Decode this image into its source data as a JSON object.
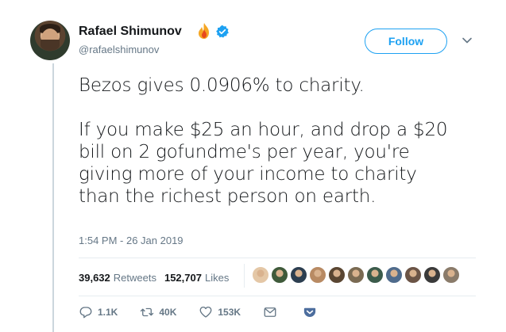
{
  "author": {
    "name": "Rafael Shimunov",
    "handle": "@rafaelshimunov",
    "badges": [
      "fire-emoji",
      "verified-badge"
    ]
  },
  "follow_label": "Follow",
  "tweet": {
    "line1": "Bezos gives 0.0906% to charity.",
    "line2": "If you make $25 an hour, and drop a $20",
    "line3": "bill on 2 gofundme's per year, you're",
    "line4": "giving more of your income to charity",
    "line5": "than the richest person on earth."
  },
  "timestamp": "1:54 PM - 26 Jan 2019",
  "stats": {
    "retweets_count": "39,632",
    "retweets_label": "Retweets",
    "likes_count": "152,707",
    "likes_label": "Likes"
  },
  "liker_colors": [
    "#e4c7a6",
    "#3f5a3a",
    "#2c3e50",
    "#b88a63",
    "#5a4632",
    "#7a6a52",
    "#3b5b4b",
    "#4f6b8c",
    "#6b5446",
    "#3a3a3a",
    "#8a7b6a"
  ],
  "actions": {
    "reply": "1.1K",
    "retweet": "40K",
    "like": "153K"
  },
  "colors": {
    "accent": "#1da1f2",
    "text": "#14171a",
    "muted": "#657786",
    "pocket": "#4d6e9e"
  }
}
